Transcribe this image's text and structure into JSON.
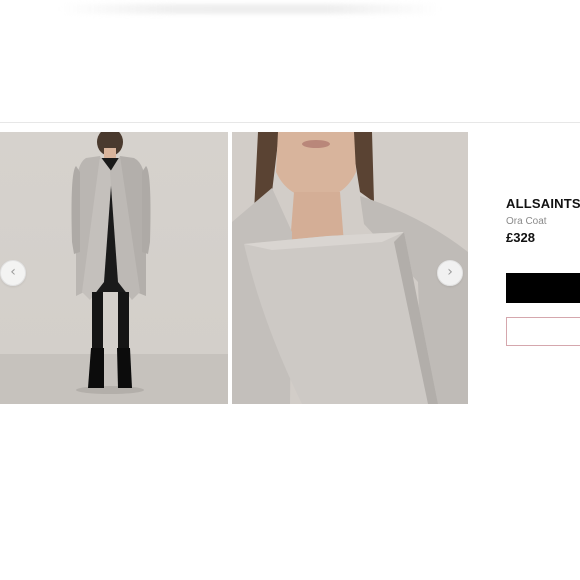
{
  "product": {
    "brand": "ALLSAINTS",
    "name": "Ora Coat",
    "price": "£328"
  },
  "gallery": {
    "prev_arrow": "‹",
    "next_arrow": "›",
    "images": [
      {
        "name": "full-length-model-photo"
      },
      {
        "name": "collar-closeup-photo"
      }
    ]
  },
  "buttons": {
    "primary_label": "",
    "secondary_label": ""
  },
  "colors": {
    "coat": "#b8b4b0",
    "background": "#d3cfca",
    "primary_button": "#000000",
    "outline_button_border": "#d5a7ad"
  }
}
